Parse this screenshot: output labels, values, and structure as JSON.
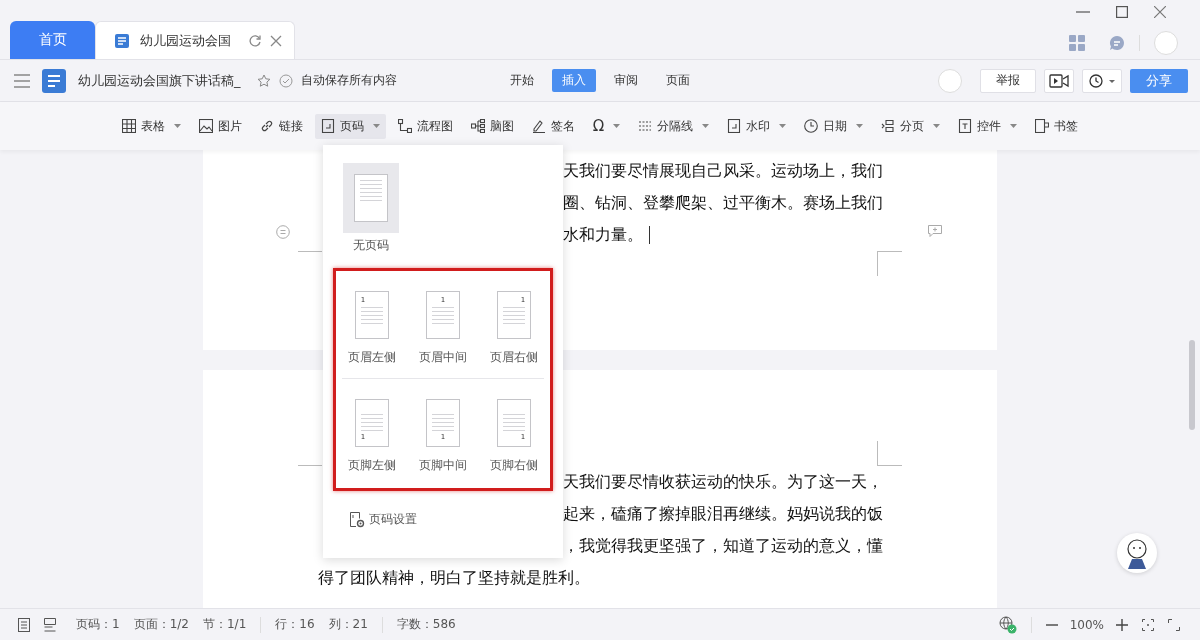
{
  "window_tabs": [
    {
      "label": "首页",
      "kind": "home",
      "selected": false
    },
    {
      "label": "幼儿园运动会国",
      "kind": "doc",
      "selected": true
    }
  ],
  "document_header": {
    "title": "幼儿园运动会国旗下讲话稿_",
    "save_status": "自动保存所有内容"
  },
  "ribbon_tabs": [
    {
      "label": "开始",
      "selected": false
    },
    {
      "label": "插入",
      "selected": true
    },
    {
      "label": "审阅",
      "selected": false
    },
    {
      "label": "页面",
      "selected": false
    }
  ],
  "header_buttons": {
    "report": "举报",
    "share": "分享"
  },
  "toolbar": [
    {
      "label": "表格",
      "dropdown": true,
      "active": false
    },
    {
      "label": "图片",
      "dropdown": false,
      "active": false
    },
    {
      "label": "链接",
      "dropdown": false,
      "active": false
    },
    {
      "label": "页码",
      "dropdown": true,
      "active": true
    },
    {
      "label": "流程图",
      "dropdown": false,
      "active": false
    },
    {
      "label": "脑图",
      "dropdown": false,
      "active": false
    },
    {
      "label": "签名",
      "dropdown": false,
      "active": false
    },
    {
      "label": "Ω",
      "dropdown": true,
      "active": false
    },
    {
      "label": "分隔线",
      "dropdown": true,
      "active": false
    },
    {
      "label": "水印",
      "dropdown": true,
      "active": false
    },
    {
      "label": "日期",
      "dropdown": true,
      "active": false
    },
    {
      "label": "分页",
      "dropdown": true,
      "active": false
    },
    {
      "label": "控件",
      "dropdown": true,
      "active": false
    },
    {
      "label": "书签",
      "dropdown": false,
      "active": false
    }
  ],
  "pages": [
    {
      "lines": [
        {
          "text": "天我们要尽情展现自己风采。运动场上，我们",
          "kind": "partial"
        },
        {
          "text": "圈、钻洞、登攀爬架、过平衡木。赛场上我们",
          "kind": "partial"
        },
        {
          "text": "水和力量。",
          "kind": "partial",
          "cursor": true
        }
      ]
    },
    {
      "lines": [
        {
          "text": "天我们要尽情收获运动的快乐。为了这一天，",
          "kind": "partial"
        },
        {
          "text": "起来，磕痛了擦掉眼泪再继续。妈妈说我的饭",
          "kind": "partial"
        },
        {
          "text": "，我觉得我更坚强了，知道了运动的意义，懂",
          "kind": "partial"
        },
        {
          "text": "得了团队精神，明白了坚持就是胜利。",
          "kind": "full"
        }
      ]
    }
  ],
  "page_number_menu": {
    "none_option": "无页码",
    "header_options": [
      {
        "label": "页眉左侧",
        "number": "1"
      },
      {
        "label": "页眉中间",
        "number": "1"
      },
      {
        "label": "页眉右侧",
        "number": "1"
      }
    ],
    "footer_options": [
      {
        "label": "页脚左侧",
        "number": "1"
      },
      {
        "label": "页脚中间",
        "number": "1"
      },
      {
        "label": "页脚右侧",
        "number": "1"
      }
    ],
    "settings": "页码设置"
  },
  "status_bar": {
    "page": "页码：1",
    "pages": "页面：1/2",
    "section": "节：1/1",
    "line": "行：16",
    "column": "列：21",
    "word_count": "字数：586",
    "zoom": "100%"
  }
}
